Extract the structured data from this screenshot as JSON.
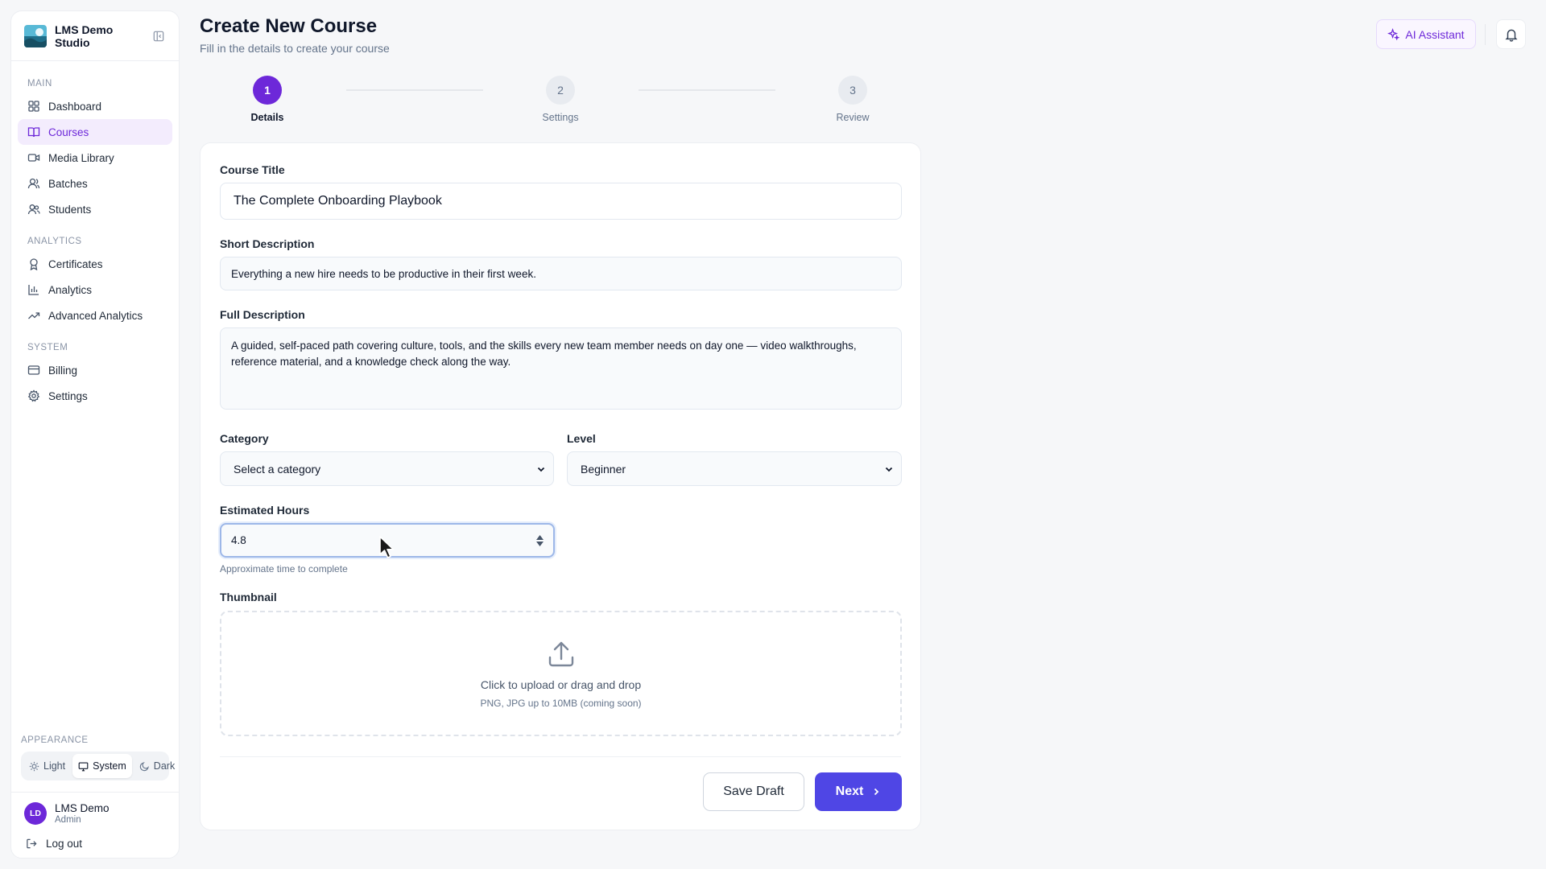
{
  "sidebar": {
    "brand_name": "LMS Demo Studio",
    "sections": {
      "main": {
        "label": "MAIN",
        "items": [
          {
            "label": "Dashboard",
            "icon": "dashboard-icon"
          },
          {
            "label": "Courses",
            "icon": "book-open-icon",
            "active": true
          },
          {
            "label": "Media Library",
            "icon": "video-icon"
          },
          {
            "label": "Batches",
            "icon": "user-group-icon"
          },
          {
            "label": "Students",
            "icon": "users-icon"
          }
        ]
      },
      "analytics": {
        "label": "ANALYTICS",
        "items": [
          {
            "label": "Certificates",
            "icon": "award-icon"
          },
          {
            "label": "Analytics",
            "icon": "bar-chart-icon"
          },
          {
            "label": "Advanced Analytics",
            "icon": "trending-up-icon"
          }
        ]
      },
      "system": {
        "label": "SYSTEM",
        "items": [
          {
            "label": "Billing",
            "icon": "credit-card-icon"
          },
          {
            "label": "Settings",
            "icon": "gear-icon"
          }
        ]
      }
    },
    "appearance": {
      "label": "APPEARANCE",
      "options": [
        "Light",
        "System",
        "Dark"
      ],
      "selected": "System"
    },
    "user": {
      "initials": "LD",
      "name": "LMS Demo",
      "role": "Admin"
    },
    "logout_label": "Log out"
  },
  "header": {
    "title": "Create New Course",
    "subtitle": "Fill in the details to create your course",
    "ai_label": "AI Assistant"
  },
  "stepper": {
    "steps": [
      {
        "number": "1",
        "label": "Details",
        "active": true
      },
      {
        "number": "2",
        "label": "Settings"
      },
      {
        "number": "3",
        "label": "Review"
      }
    ]
  },
  "form": {
    "title_label": "Course Title",
    "title_value": "The Complete Onboarding Playbook",
    "short_label": "Short Description",
    "short_value": "Everything a new hire needs to be productive in their first week.",
    "full_label": "Full Description",
    "full_value": "A guided, self-paced path covering culture, tools, and the skills every new team member needs on day one — video walkthroughs, reference material, and a knowledge check along the way.",
    "category_label": "Category",
    "category_value": "Select a category",
    "level_label": "Level",
    "level_value": "Beginner",
    "hours_label": "Estimated Hours",
    "hours_value": "4.8",
    "hours_helper": "Approximate time to complete",
    "thumbnail_label": "Thumbnail",
    "upload_text": "Click to upload or drag and drop",
    "upload_sub": "PNG, JPG up to 10MB (coming soon)",
    "save_draft_label": "Save Draft",
    "next_label": "Next"
  },
  "colors": {
    "accent": "#6d28d9",
    "primary_button": "#4f46e5",
    "active_nav_bg": "#f3ecfd"
  }
}
